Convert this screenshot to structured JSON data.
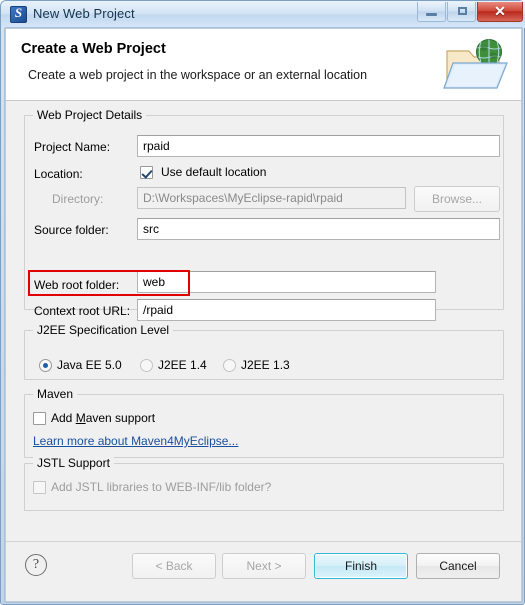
{
  "window": {
    "title": "New Web Project",
    "icon": "myeclipse-logo-icon",
    "minimize_label": "",
    "maximize_label": "",
    "close_label": "✕"
  },
  "banner": {
    "title": "Create a Web Project",
    "subtitle": "Create a web project in the workspace or an external location",
    "icon": "web-folder-globe-icon"
  },
  "details_group": {
    "title": "Web Project Details",
    "project_name": {
      "label": "Project Name:",
      "value": "rpaid",
      "placeholder": ""
    },
    "location": {
      "label": "Location:",
      "checkbox_label": "Use default location",
      "checked": true
    },
    "directory": {
      "label": "Directory:",
      "value": "D:\\Workspaces\\MyEclipse-rapid\\rpaid",
      "browse_label": "Browse...",
      "browse_mnemonic": "r",
      "enabled": false
    },
    "source_folder": {
      "label": "Source folder:",
      "value": "src"
    },
    "web_root_folder": {
      "label": "Web root folder:",
      "value": "web",
      "highlighted": true
    },
    "context_root_url": {
      "label": "Context root URL:",
      "value": "/rpaid"
    }
  },
  "j2ee_group": {
    "title": "J2EE Specification Level",
    "options": [
      {
        "label": "Java EE 5.0",
        "selected": true
      },
      {
        "label": "J2EE 1.4",
        "selected": false
      },
      {
        "label": "J2EE 1.3",
        "selected": false
      }
    ]
  },
  "maven_group": {
    "title": "Maven",
    "checkbox_label_pre": "Add ",
    "checkbox_mnemonic": "M",
    "checkbox_label_post": "aven support",
    "checked": false,
    "link_label": "Learn more about Maven4MyEclipse..."
  },
  "jstl_group": {
    "title": "JSTL Support",
    "checkbox_label": "Add JSTL libraries to WEB-INF/lib folder?",
    "checked": false,
    "enabled": false
  },
  "buttons": {
    "help": "?",
    "back": {
      "label": "< Back",
      "enabled": false
    },
    "next": {
      "label": "Next >",
      "enabled": false
    },
    "finish": {
      "label": "Finish",
      "default": true
    },
    "cancel": {
      "label": "Cancel"
    }
  },
  "colors": {
    "accent": "#2fb8d8",
    "highlight": "#e00000",
    "link": "#1a4f9c",
    "titlebar": "#d3e4f5"
  }
}
